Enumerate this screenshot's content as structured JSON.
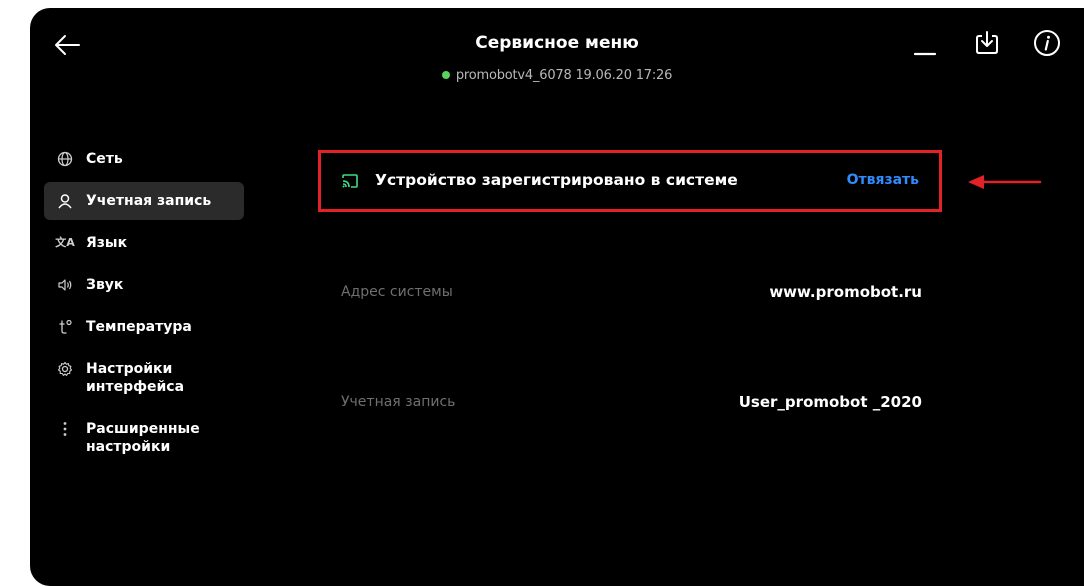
{
  "header": {
    "title": "Сервисное меню",
    "status_text": "promobotv4_6078 19.06.20  17:26",
    "status_color": "#5ad35a"
  },
  "sidebar": {
    "items": [
      {
        "label": "Сеть",
        "icon": "globe-icon",
        "active": false
      },
      {
        "label": "Учетная запись",
        "icon": "user-icon",
        "active": true
      },
      {
        "label": "Язык",
        "icon": "translate-icon",
        "active": false
      },
      {
        "label": "Звук",
        "icon": "speaker-icon",
        "active": false
      },
      {
        "label": "Температура",
        "icon": "temperature-icon",
        "active": false
      },
      {
        "label": "Настройки\nинтерфейса",
        "icon": "gear-icon",
        "active": false
      },
      {
        "label": "Расширенные\nнастройки",
        "icon": "more-vertical-icon",
        "active": false
      }
    ]
  },
  "registration": {
    "text": "Устройство зарегистрировано в системе",
    "action": "Отвязать",
    "icon": "cast-icon",
    "highlight_color": "#e22226"
  },
  "rows": [
    {
      "label": "Адрес системы",
      "value": "www.promobot.ru"
    },
    {
      "label": "Учетная запись",
      "value": "User_promobot _2020"
    }
  ],
  "colors": {
    "accent": "#2f8cff",
    "background": "#000000",
    "annotation": "#e22226"
  }
}
